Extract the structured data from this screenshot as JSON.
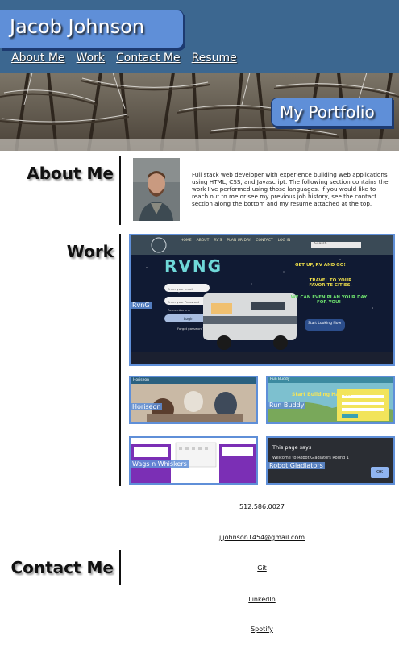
{
  "header": {
    "name": "Jacob Johnson",
    "nav": [
      "About Me",
      "Work",
      "Contact Me",
      "Resume"
    ]
  },
  "hero": {
    "title": "My Portfolio"
  },
  "about": {
    "heading": "About Me",
    "text": "Full stack web developer with experience building web applications using HTML, CSS, and Javascript. The following section contains the work I've performed using those languages. If you would like to reach out to me or see my previous job history, see the contact section along the bottom and my resume attached at the top."
  },
  "work": {
    "heading": "Work",
    "projects": [
      {
        "label": "RvnG",
        "screen": {
          "nav": [
            "HOME",
            "ABOUT",
            "RV'S",
            "PLAN UR DAY",
            "CONTACT",
            "LOG IN"
          ],
          "search_placeholder": "Search",
          "logo": "RVNG",
          "tagline1": "GET UP, RV AND GO!",
          "tagline2": "TRAVEL TO YOUR FAVORITE CITIES.",
          "tagline3": "WE CAN EVEN PLAN YOUR DAY FOR YOU!",
          "cta": "Start Looking Now",
          "email_placeholder": "Enter your email",
          "password_placeholder": "Enter your Password",
          "remember": "Remember me",
          "login": "Login",
          "forgot": "Forgot password?"
        }
      },
      {
        "label": "Horiseon",
        "screen": {
          "brand": "Horiseon"
        }
      },
      {
        "label": "Run Buddy",
        "screen": {
          "brand": "Run Buddy",
          "headline": "Start Building Habits."
        }
      },
      {
        "label": "Wags n Whiskers",
        "screen": {
          "brand": "Wags n Whiskers"
        }
      },
      {
        "label": "Robot Gladiators",
        "screen": {
          "dialog_title": "This page says",
          "dialog_message": "Welcome to Robot Gladiators Round 1",
          "ok": "OK"
        }
      }
    ]
  },
  "contact": {
    "heading": "Contact Me",
    "links": [
      "512.586.0027",
      "jljohnson1454@gmail.com",
      "Git",
      "LinkedIn",
      "Spotify"
    ]
  },
  "colors": {
    "header": "#3c6790",
    "accent": "#5f8fd8",
    "accent_dark": "#1d3a70"
  }
}
